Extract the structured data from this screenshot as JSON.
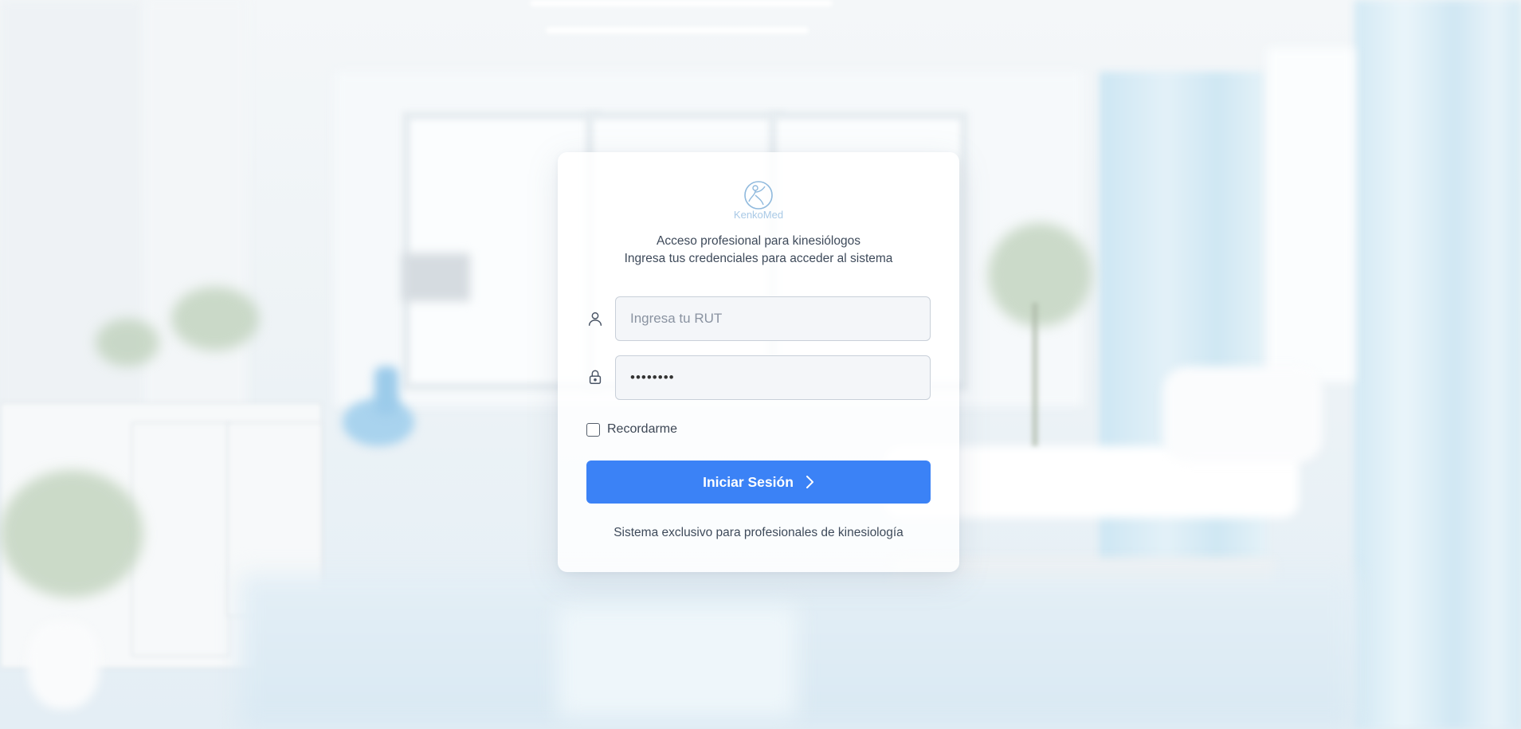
{
  "background": {
    "description_icon": "clinic-room-background"
  },
  "brand": {
    "logo_text": "KenkoMed",
    "accent_color": "#3b82f6"
  },
  "login": {
    "subtitle_line1": "Acceso profesional para kinesiólogos",
    "subtitle_line2": "Ingresa tus credenciales para acceder al sistema",
    "rut_placeholder": "Ingresa tu RUT",
    "rut_value": "",
    "rut_icon": "user-icon",
    "password_value": "••••••••",
    "password_icon": "lock-icon",
    "remember_label": "Recordarme",
    "remember_checked": false,
    "submit_label": "Iniciar Sesión",
    "submit_icon": "chevron-right-icon",
    "footer_note": "Sistema exclusivo para profesionales de kinesiología"
  }
}
